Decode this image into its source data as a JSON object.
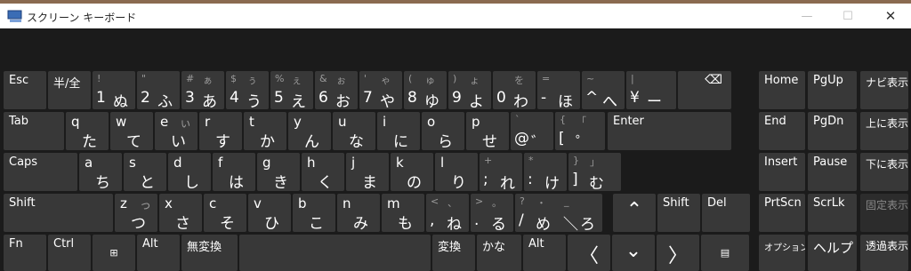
{
  "window": {
    "title": "スクリーン キーボード",
    "minimize": "—",
    "maximize": "☐",
    "close": "✕"
  },
  "row1": [
    {
      "label": "Esc"
    },
    {
      "label": "半/全"
    },
    {
      "tl": "!",
      "bl": "1",
      "br": "ぬ"
    },
    {
      "tl": "\"",
      "bl": "2",
      "br": "ふ"
    },
    {
      "tl": "#",
      "tr": "ぁ",
      "bl": "3",
      "br": "あ"
    },
    {
      "tl": "$",
      "tr": "ぅ",
      "bl": "4",
      "br": "う"
    },
    {
      "tl": "%",
      "tr": "ぇ",
      "bl": "5",
      "br": "え"
    },
    {
      "tl": "&",
      "tr": "ぉ",
      "bl": "6",
      "br": "お"
    },
    {
      "tl": "'",
      "tr": "ゃ",
      "bl": "7",
      "br": "や"
    },
    {
      "tl": "(",
      "tr": "ゅ",
      "bl": "8",
      "br": "ゆ"
    },
    {
      "tl": ")",
      "tr": "ょ",
      "bl": "9",
      "br": "よ"
    },
    {
      "tr": "を",
      "bl": "0",
      "br": "わ"
    },
    {
      "tl": "=",
      "bl": "-",
      "br": "ほ"
    },
    {
      "tl": "~",
      "bl": "^",
      "br": "へ"
    },
    {
      "tl": "|",
      "bl": "¥",
      "br": "ー"
    },
    {
      "label": "⌫"
    }
  ],
  "row2": [
    {
      "label": "Tab"
    },
    {
      "ml": "q",
      "kana": "た"
    },
    {
      "ml": "w",
      "kana": "て"
    },
    {
      "ml": "e",
      "mr": "ぃ",
      "kana": "い"
    },
    {
      "ml": "r",
      "kana": "す"
    },
    {
      "ml": "t",
      "kana": "か"
    },
    {
      "ml": "y",
      "kana": "ん"
    },
    {
      "ml": "u",
      "kana": "な"
    },
    {
      "ml": "i",
      "kana": "に"
    },
    {
      "ml": "o",
      "kana": "ら"
    },
    {
      "ml": "p",
      "kana": "せ"
    },
    {
      "tl": "`",
      "bl": "@",
      "br": "゛"
    },
    {
      "tl": "{",
      "tr": "「",
      "bl": "[",
      "br": "゜"
    },
    {
      "label": "Enter"
    }
  ],
  "row3": [
    {
      "label": "Caps"
    },
    {
      "ml": "a",
      "kana": "ち"
    },
    {
      "ml": "s",
      "kana": "と"
    },
    {
      "ml": "d",
      "kana": "し"
    },
    {
      "ml": "f",
      "kana": "は"
    },
    {
      "ml": "g",
      "kana": "き"
    },
    {
      "ml": "h",
      "kana": "く"
    },
    {
      "ml": "j",
      "kana": "ま"
    },
    {
      "ml": "k",
      "kana": "の"
    },
    {
      "ml": "l",
      "kana": "り"
    },
    {
      "tl": "+",
      "bl": ";",
      "br": "れ"
    },
    {
      "tl": "*",
      "bl": ":",
      "br": "け"
    },
    {
      "tl": "}",
      "tr": "」",
      "bl": "]",
      "br": "む"
    }
  ],
  "row4": [
    {
      "label": "Shift"
    },
    {
      "ml": "z",
      "mr": "っ",
      "kana": "つ"
    },
    {
      "ml": "x",
      "kana": "さ"
    },
    {
      "ml": "c",
      "kana": "そ"
    },
    {
      "ml": "v",
      "kana": "ひ"
    },
    {
      "ml": "b",
      "kana": "こ"
    },
    {
      "ml": "n",
      "kana": "み"
    },
    {
      "ml": "m",
      "kana": "も"
    },
    {
      "tl": "<",
      "tr": "、",
      "bl": ",",
      "br": "ね"
    },
    {
      "tl": ">",
      "tr": "。",
      "bl": ".",
      "br": "る"
    },
    {
      "tl": "?",
      "tr": "・",
      "bl": "/",
      "br": "め"
    },
    {
      "tl": "_",
      "bl": "＼",
      "br": "ろ"
    },
    {
      "label": "⌃"
    },
    {
      "label": "Shift"
    },
    {
      "label": "Del"
    }
  ],
  "row5": [
    {
      "label": "Fn"
    },
    {
      "label": "Ctrl"
    },
    {
      "label": "⊞"
    },
    {
      "label": "Alt"
    },
    {
      "label": "無変換"
    },
    {
      "label": ""
    },
    {
      "label": "変換"
    },
    {
      "label": "かな"
    },
    {
      "label": "Alt"
    },
    {
      "label": "〈"
    },
    {
      "label": "⌄"
    },
    {
      "label": "〉"
    },
    {
      "label": "▤"
    }
  ],
  "nav": [
    [
      "Home",
      "PgUp",
      "ナビ表示"
    ],
    [
      "End",
      "PgDn",
      "上に表示"
    ],
    [
      "Insert",
      "Pause",
      "下に表示"
    ],
    [
      "PrtScn",
      "ScrLk",
      "固定表示"
    ],
    [
      "オプション",
      "ヘルプ",
      "透過表示"
    ]
  ]
}
